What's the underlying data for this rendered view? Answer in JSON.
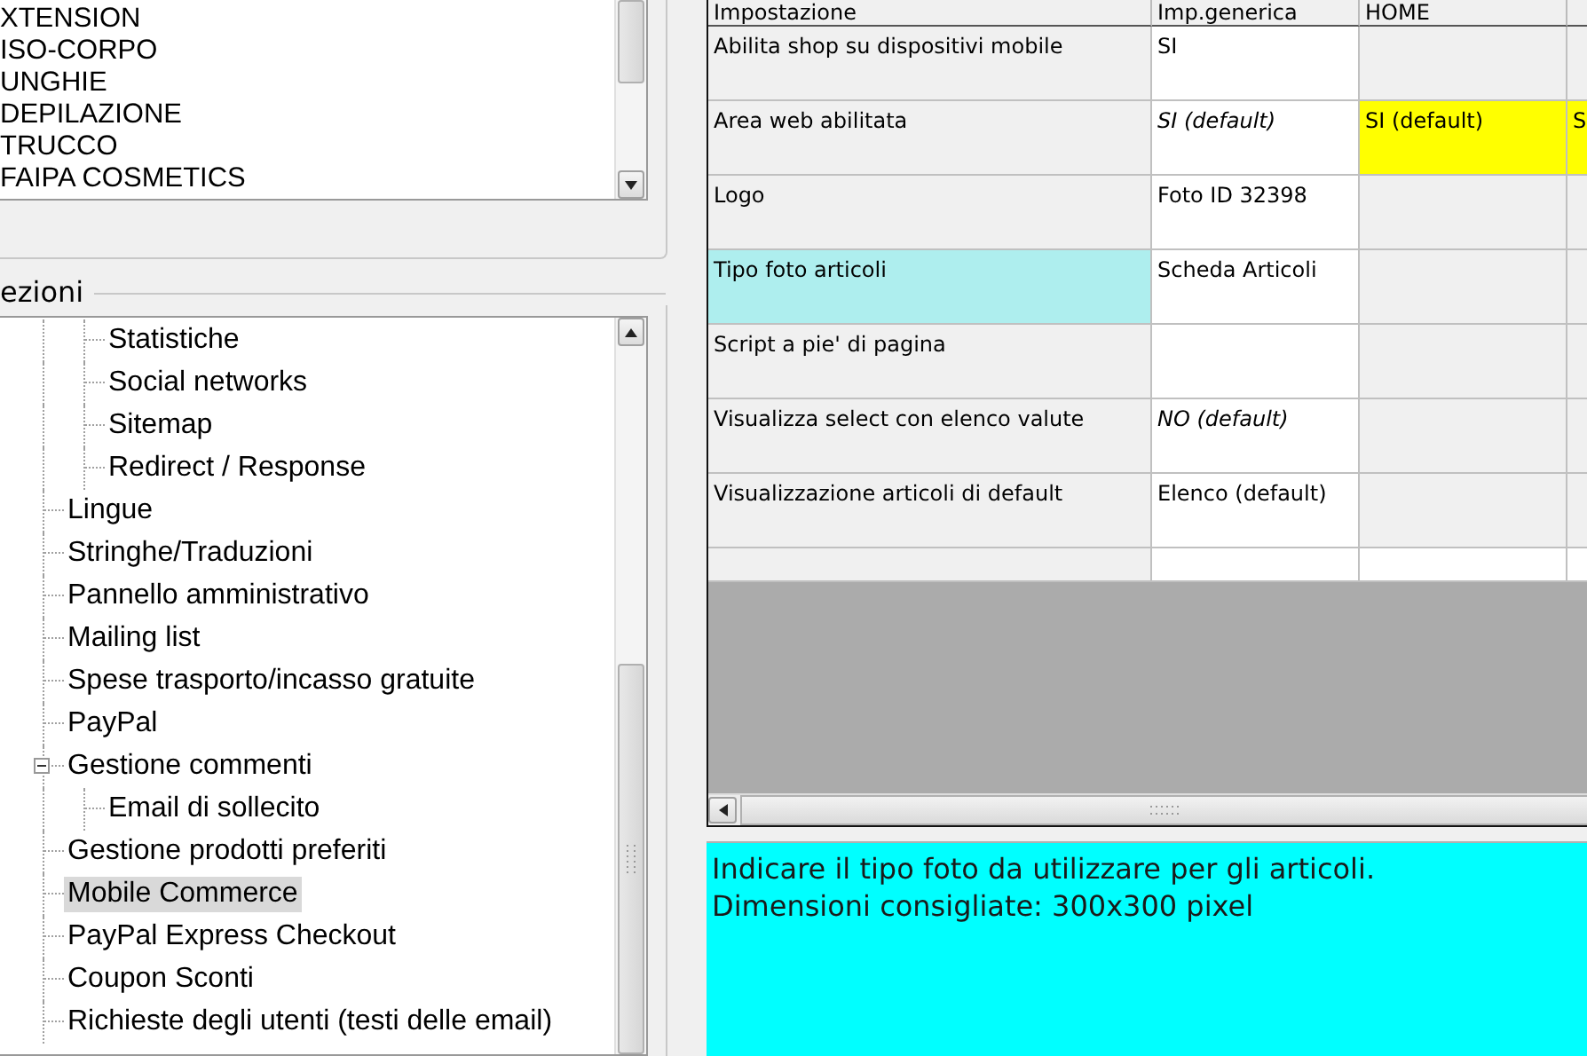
{
  "category_list": {
    "items": [
      {
        "label": "XTENSION",
        "selected": false
      },
      {
        "label": "ISO-CORPO",
        "selected": false
      },
      {
        "label": "UNGHIE",
        "selected": false
      },
      {
        "label": "DEPILAZIONE",
        "selected": false
      },
      {
        "label": "TRUCCO",
        "selected": false
      },
      {
        "label": "FAIPA COSMETICS",
        "selected": false
      }
    ]
  },
  "sections": {
    "title": "ezioni",
    "items": [
      {
        "children": [
          {
            "label": "Statistiche",
            "selected": false
          },
          {
            "label": "Social networks",
            "selected": false
          },
          {
            "label": "Sitemap",
            "selected": false
          },
          {
            "label": "Redirect / Response",
            "selected": false
          }
        ]
      },
      {
        "label": "Lingue",
        "selected": false
      },
      {
        "label": "Stringhe/Traduzioni",
        "selected": false
      },
      {
        "label": "Pannello amministrativo",
        "selected": false
      },
      {
        "label": "Mailing list",
        "selected": false
      },
      {
        "label": "Spese trasporto/incasso gratuite",
        "selected": false
      },
      {
        "label": "PayPal",
        "selected": false
      },
      {
        "label": "Gestione commenti",
        "selected": false,
        "expanded": true,
        "children": [
          {
            "label": "Email di sollecito",
            "selected": false
          }
        ]
      },
      {
        "label": "Gestione prodotti preferiti",
        "selected": false
      },
      {
        "label": "Mobile Commerce",
        "selected": true
      },
      {
        "label": "PayPal Express Checkout",
        "selected": false
      },
      {
        "label": "Coupon Sconti",
        "selected": false
      },
      {
        "label": "Richieste degli utenti (testi delle email)",
        "selected": false
      }
    ]
  },
  "settings_table": {
    "columns": [
      "Impostazione",
      "Imp.generica",
      "HOME"
    ],
    "rows": [
      {
        "selected": false,
        "cells": [
          {
            "text": "Abilita shop su dispositivi mobile",
            "italic": false
          },
          {
            "text": "SI",
            "italic": false
          }
        ]
      },
      {
        "selected": false,
        "cells": [
          {
            "text": "Area web abilitata",
            "italic": false
          },
          {
            "text": "SI (default)",
            "italic": true
          },
          {
            "text": "SI (default)",
            "italic": false,
            "color": "#ffff00"
          },
          {
            "text": "S",
            "italic": false,
            "color": "#ffff00"
          }
        ]
      },
      {
        "selected": false,
        "cells": [
          {
            "text": "Logo",
            "italic": false
          },
          {
            "text": "Foto ID 32398",
            "italic": false
          }
        ]
      },
      {
        "selected": true,
        "cells": [
          {
            "text": "Tipo foto articoli",
            "italic": false
          },
          {
            "text": "Scheda Articoli",
            "italic": false
          }
        ]
      },
      {
        "selected": false,
        "cells": [
          {
            "text": "Script a pie' di pagina",
            "italic": false
          }
        ]
      },
      {
        "selected": false,
        "cells": [
          {
            "text": "Visualizza select con elenco valute",
            "italic": false
          },
          {
            "text": "NO (default)",
            "italic": true
          }
        ]
      },
      {
        "selected": false,
        "cells": [
          {
            "text": "Visualizzazione articoli di default",
            "italic": false
          },
          {
            "text": "Elenco (default)",
            "italic": false
          }
        ]
      }
    ]
  },
  "description": [
    "Indicare il tipo foto da utilizzare per gli articoli.",
    "Dimensioni consigliate: 300x300 pixel"
  ]
}
